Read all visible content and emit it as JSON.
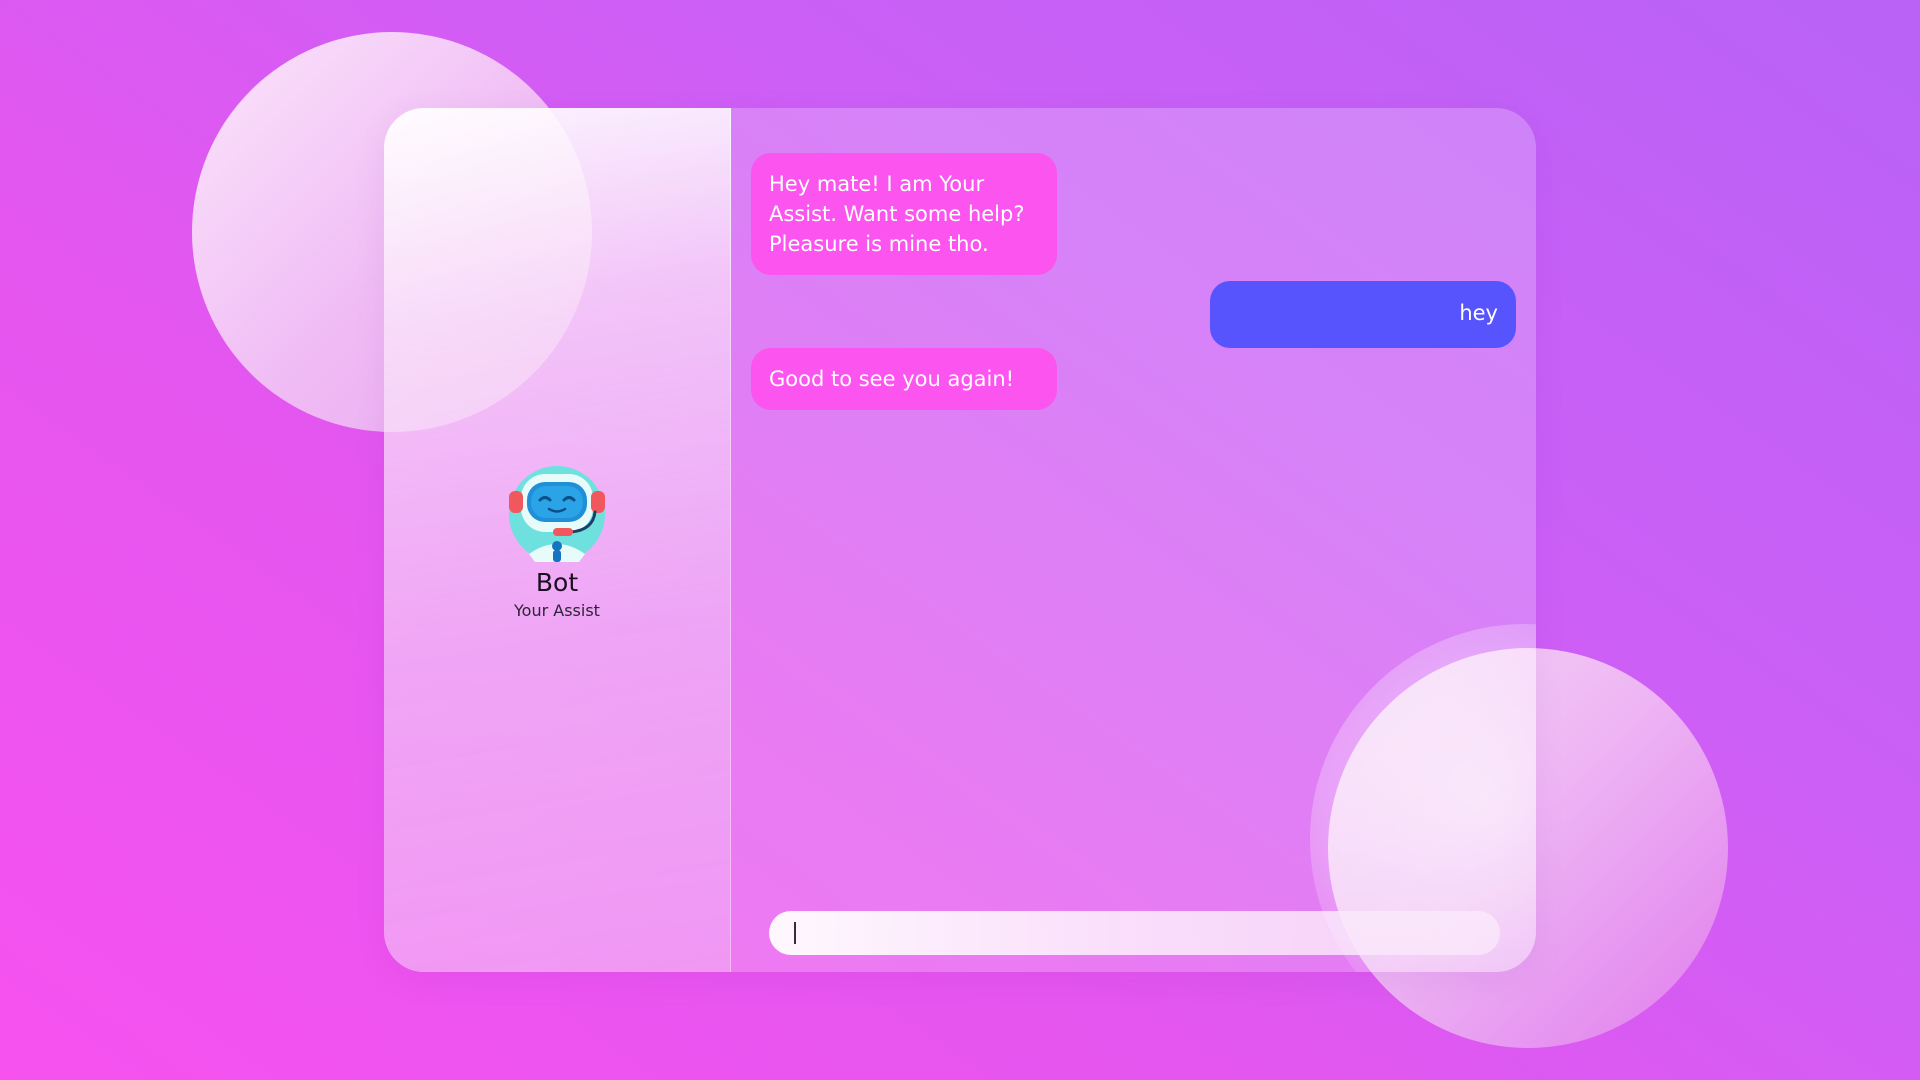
{
  "app": {
    "colors": {
      "bot_bubble": "#fc54ee",
      "user_bubble": "#5753fd",
      "background_start": "#f752f0",
      "background_end": "#b962f6"
    }
  },
  "sidebar": {
    "avatar_icon": "robot-headset-icon",
    "name": "Bot",
    "subtitle": "Your Assist"
  },
  "chat": {
    "messages": [
      {
        "sender": "bot",
        "text": "Hey mate! I am Your Assist. Want some help? Pleasure is mine tho."
      },
      {
        "sender": "user",
        "text": "hey"
      },
      {
        "sender": "bot",
        "text": "Good to see you again!"
      }
    ],
    "input": {
      "value": "",
      "placeholder": ""
    }
  }
}
